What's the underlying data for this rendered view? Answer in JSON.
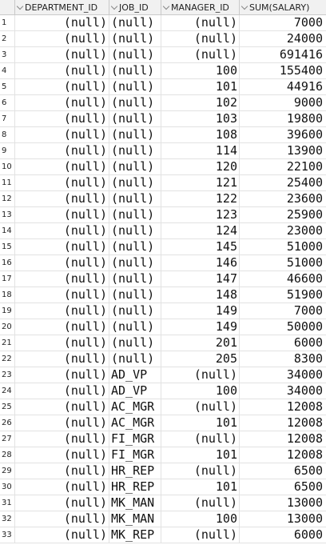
{
  "columns": [
    "DEPARTMENT_ID",
    "JOB_ID",
    "MANAGER_ID",
    "SUM(SALARY)"
  ],
  "rows": [
    [
      "1",
      "(null)",
      "(null)",
      "(null)",
      "7000"
    ],
    [
      "2",
      "(null)",
      "(null)",
      "(null)",
      "24000"
    ],
    [
      "3",
      "(null)",
      "(null)",
      "(null)",
      "691416"
    ],
    [
      "4",
      "(null)",
      "(null)",
      "100",
      "155400"
    ],
    [
      "5",
      "(null)",
      "(null)",
      "101",
      "44916"
    ],
    [
      "6",
      "(null)",
      "(null)",
      "102",
      "9000"
    ],
    [
      "7",
      "(null)",
      "(null)",
      "103",
      "19800"
    ],
    [
      "8",
      "(null)",
      "(null)",
      "108",
      "39600"
    ],
    [
      "9",
      "(null)",
      "(null)",
      "114",
      "13900"
    ],
    [
      "10",
      "(null)",
      "(null)",
      "120",
      "22100"
    ],
    [
      "11",
      "(null)",
      "(null)",
      "121",
      "25400"
    ],
    [
      "12",
      "(null)",
      "(null)",
      "122",
      "23600"
    ],
    [
      "13",
      "(null)",
      "(null)",
      "123",
      "25900"
    ],
    [
      "14",
      "(null)",
      "(null)",
      "124",
      "23000"
    ],
    [
      "15",
      "(null)",
      "(null)",
      "145",
      "51000"
    ],
    [
      "16",
      "(null)",
      "(null)",
      "146",
      "51000"
    ],
    [
      "17",
      "(null)",
      "(null)",
      "147",
      "46600"
    ],
    [
      "18",
      "(null)",
      "(null)",
      "148",
      "51900"
    ],
    [
      "19",
      "(null)",
      "(null)",
      "149",
      "7000"
    ],
    [
      "20",
      "(null)",
      "(null)",
      "149",
      "50000"
    ],
    [
      "21",
      "(null)",
      "(null)",
      "201",
      "6000"
    ],
    [
      "22",
      "(null)",
      "(null)",
      "205",
      "8300"
    ],
    [
      "23",
      "(null)",
      "AD_VP",
      "(null)",
      "34000"
    ],
    [
      "24",
      "(null)",
      "AD_VP",
      "100",
      "34000"
    ],
    [
      "25",
      "(null)",
      "AC_MGR",
      "(null)",
      "12008"
    ],
    [
      "26",
      "(null)",
      "AC_MGR",
      "101",
      "12008"
    ],
    [
      "27",
      "(null)",
      "FI_MGR",
      "(null)",
      "12008"
    ],
    [
      "28",
      "(null)",
      "FI_MGR",
      "101",
      "12008"
    ],
    [
      "29",
      "(null)",
      "HR_REP",
      "(null)",
      "6500"
    ],
    [
      "30",
      "(null)",
      "HR_REP",
      "101",
      "6500"
    ],
    [
      "31",
      "(null)",
      "MK_MAN",
      "(null)",
      "13000"
    ],
    [
      "32",
      "(null)",
      "MK_MAN",
      "100",
      "13000"
    ],
    [
      "33",
      "(null)",
      "MK_REP",
      "(null)",
      "6000"
    ]
  ]
}
